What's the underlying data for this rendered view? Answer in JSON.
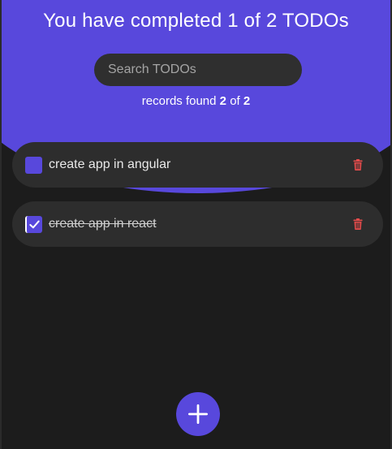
{
  "header": {
    "title": "You have completed 1 of 2 TODOs"
  },
  "search": {
    "placeholder": "Search TODOs",
    "value": ""
  },
  "records": {
    "prefix": "records found",
    "found": "2",
    "of_label": "of",
    "total": "2"
  },
  "todos": [
    {
      "label": "create app in angular",
      "completed": false
    },
    {
      "label": "create app in react",
      "completed": true
    }
  ],
  "colors": {
    "accent": "#5848dc",
    "background": "#1c1c1c",
    "card": "#2d2d2d",
    "delete": "#e34b4b"
  },
  "icons": {
    "delete": "trash-icon",
    "check": "check-icon",
    "add": "plus-icon"
  }
}
